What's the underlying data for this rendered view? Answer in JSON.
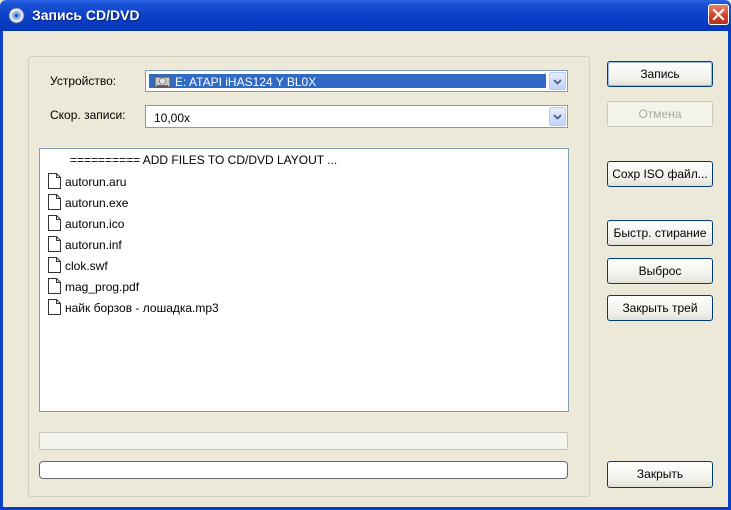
{
  "window": {
    "title": "Запись CD/DVD"
  },
  "device": {
    "label": "Устройство:",
    "value": "E: ATAPI iHAS124   Y BL0X"
  },
  "speed": {
    "label": "Скор. записи:",
    "value": "10,00x"
  },
  "buttons": {
    "write": "Запись",
    "cancel": "Отмена",
    "save_iso": "Сохр ISO файл...",
    "quick_erase": "Быстр. стирание",
    "eject": "Выброс",
    "close_tray": "Закрыть трей",
    "close": "Закрыть"
  },
  "file_list": {
    "header": "========== ADD FILES TO CD/DVD LAYOUT ...",
    "items": [
      "autorun.aru",
      "autorun.exe",
      "autorun.ico",
      "autorun.inf",
      "clok.swf",
      "mag_prog.pdf",
      "найк борзов - лошадка.mp3"
    ]
  },
  "colors": {
    "titlebar": "#0A3FC8",
    "dialog_bg": "#ECE9D8",
    "selection": "#316AC5"
  }
}
